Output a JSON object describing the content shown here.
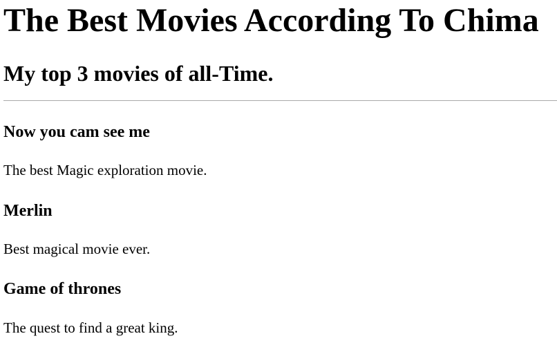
{
  "header": {
    "title": "The Best Movies According To Chima",
    "subtitle": "My top 3 movies of all-Time."
  },
  "movies": [
    {
      "title": "Now you cam see me",
      "description": "The best Magic exploration movie."
    },
    {
      "title": "Merlin",
      "description": "Best magical movie ever."
    },
    {
      "title": "Game of thrones",
      "description": "The quest to find a great king."
    }
  ],
  "colors": {
    "text": "#000000",
    "background": "#ffffff",
    "divider": "#a8a8a8"
  }
}
